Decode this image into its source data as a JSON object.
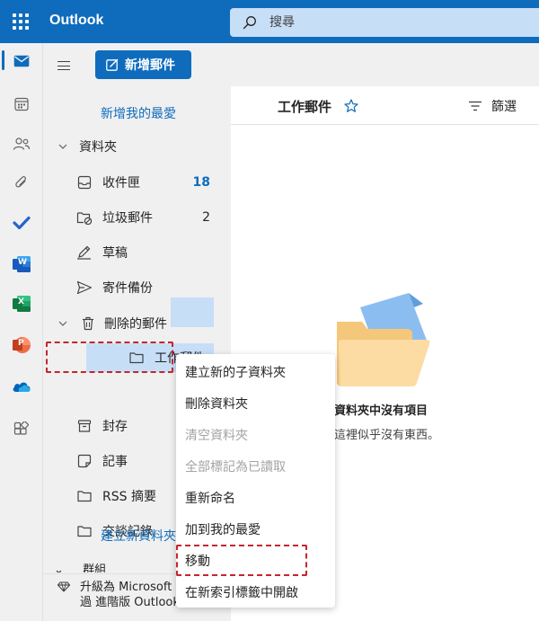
{
  "topbar": {
    "app_name": "Outlook",
    "search_placeholder": "搜尋"
  },
  "colors": {
    "accent": "#0f6cbd",
    "selection": "#c7def7",
    "highlight_box": "#c4262e"
  },
  "rail": {
    "icons": [
      "mail-icon",
      "calendar-icon",
      "people-icon",
      "attach-icon",
      "todo-icon",
      "word-icon",
      "excel-icon",
      "powerpoint-icon",
      "onedrive-icon",
      "apps-icon"
    ],
    "word_letter": "W",
    "excel_letter": "X",
    "powerpoint_letter": "P"
  },
  "folder_pane": {
    "new_mail_label": "新增郵件",
    "add_favorite": "新增我的最愛",
    "folders_header": "資料夾",
    "folders": [
      {
        "name": "收件匣",
        "count": "18",
        "icon": "inbox-icon"
      },
      {
        "name": "垃圾郵件",
        "count": "2",
        "icon": "junk-icon"
      },
      {
        "name": "草稿",
        "count": "",
        "icon": "drafts-icon"
      },
      {
        "name": "寄件備份",
        "count": "",
        "icon": "sent-icon"
      }
    ],
    "deleted_header": "刪除的郵件",
    "selected_folder": "工作郵件",
    "more_folders": [
      {
        "name": "封存",
        "icon": "archive-icon"
      },
      {
        "name": "記事",
        "icon": "notes-icon"
      },
      {
        "name": "RSS 摘要",
        "icon": "folder-icon"
      },
      {
        "name": "交談記錄",
        "icon": "folder-icon"
      }
    ],
    "create_folder": "建立新資料夾",
    "groups_header": "群組",
    "upgrade_text": "升級為 Microsoft 365，透過 進階版 Outlook 功能"
  },
  "list": {
    "title": "工作郵件",
    "filter_label": "篩選",
    "empty_title": "資料夾中沒有項目",
    "empty_sub": "這裡似乎沒有東西。"
  },
  "context_menu": {
    "items": [
      {
        "label": "建立新的子資料夾",
        "disabled": false
      },
      {
        "label": "刪除資料夾",
        "disabled": false
      },
      {
        "label": "清空資料夾",
        "disabled": true
      },
      {
        "label": "全部標記為已讀取",
        "disabled": true
      },
      {
        "label": "重新命名",
        "disabled": false
      },
      {
        "label": "加到我的最愛",
        "disabled": false
      },
      {
        "label": "移動",
        "disabled": false
      },
      {
        "label": "在新索引標籤中開啟",
        "disabled": false
      }
    ]
  }
}
